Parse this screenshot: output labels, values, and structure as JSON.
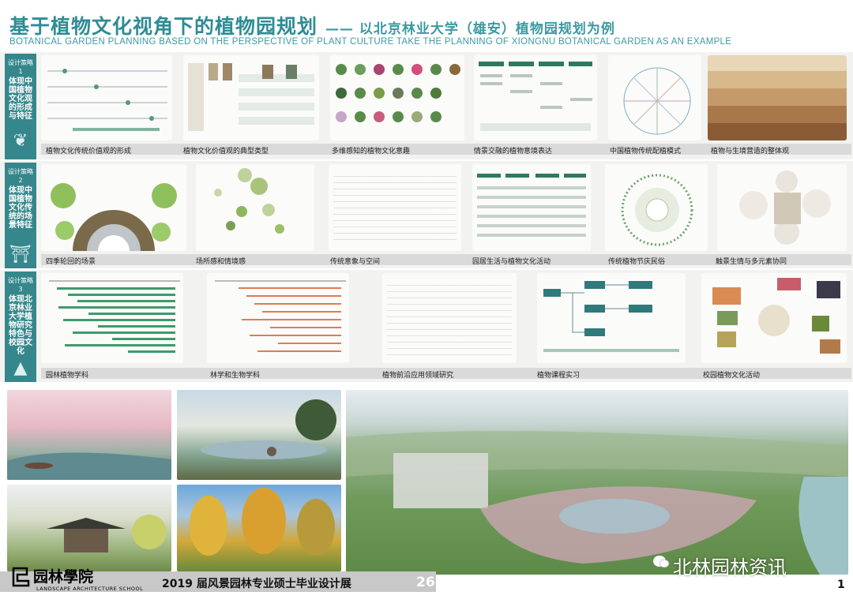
{
  "header": {
    "title": "基于植物文化视角下的植物园规划",
    "title_sub": "—— 以北京林业大学（雄安）植物园规划为例",
    "subtitle": "BOTANICAL GARDEN PLANNING BASED ON THE PERSPECTIVE OF PLANT CULTURE TAKE THE PLANNING OF XIONGNU BOTANICAL GARDEN AS AN EXAMPLE"
  },
  "strategies": [
    {
      "tag": "设计策略1",
      "label": "体现中国植物文化观的形成与特征",
      "icon": "bamboo-icon",
      "captions": [
        "植物文化传统价值观的形成",
        "植物文化价值观的典型类型",
        "多维感知的植物文化意趣",
        "情景交融的植物意境表达",
        "中国植物传统配植模式",
        "植物与生境营造的整体观"
      ]
    },
    {
      "tag": "设计策略2",
      "label": "体现中国植物文化传统的场景特征",
      "icon": "pavilion-gate-icon",
      "captions": [
        "四季轮回的场景",
        "场所感和情境感",
        "传统意象与空间",
        "园居生活与植物文化活动",
        "传统植物节庆民俗",
        "触景生情与多元素协同"
      ]
    },
    {
      "tag": "设计策略3",
      "label": "体现北京林业大学植物研究特色与校园文化",
      "icon": "tree-icon",
      "captions": [
        "园林植物学科",
        "林学和生物学科",
        "植物前沿应用领域研究",
        "植物课程实习",
        "校园植物文化活动"
      ]
    }
  ],
  "footer": {
    "logo_cn": "园林學院",
    "logo_en": "LANDSCAPE ARCHITECTURE SCHOOL",
    "exhibit": "2019 届风景园林专业硕士毕业设计展",
    "exhibit_num": "26",
    "page": "1",
    "watermark": "北林园林资讯"
  },
  "colors": {
    "accent": "#2f8c93",
    "strip": "#35878c"
  }
}
